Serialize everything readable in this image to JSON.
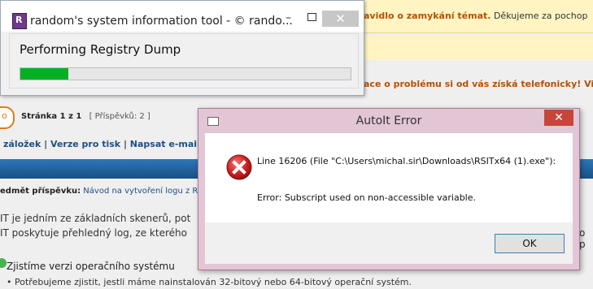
{
  "forum": {
    "notice1_link": "avidlo o zamykání témat.",
    "notice1_rest": " Děkujeme za pochop",
    "notice2": "ace o problému si od vás získá telefonicky! Vi",
    "round_btn": "o",
    "pages_label": "Stránka 1 z 1",
    "posts_label": "[ Příspěvků: 2 ]",
    "links": [
      "záložek",
      "Verze pro tisk",
      "Napsat e-mail"
    ],
    "link_sep": " | ",
    "subject_label": "edmět příspěvku:",
    "subject_value": "Návod na vytvoření logu z R",
    "body_line1": "IT je jedním ze základních skenerů, pot",
    "body_line2": "IT poskytuje přehledný log, ze kterého",
    "body_line2_right": "o p",
    "heading": "Zjistíme verzi operačního systému",
    "bullet": "Potřebujeme zjistit, jestli máme nainstalován 32-bitový nebo 64-bitový operační systém."
  },
  "rsit": {
    "app_icon_letter": "R",
    "title": "random's system information tool - © rando...",
    "minimize": "–",
    "close": "✕",
    "status": "Performing Registry Dump",
    "progress": 0.145,
    "progress_color": "#06b025"
  },
  "dialog": {
    "title": "AutoIt Error",
    "close": "✕",
    "line": "Line 16206  (File \"C:\\Users\\michal.sir\\Downloads\\RSITx64 (1).exe\"):",
    "message": "Error: Subscript used on non-accessible variable.",
    "ok_label": "OK",
    "icon": "error-icon"
  }
}
